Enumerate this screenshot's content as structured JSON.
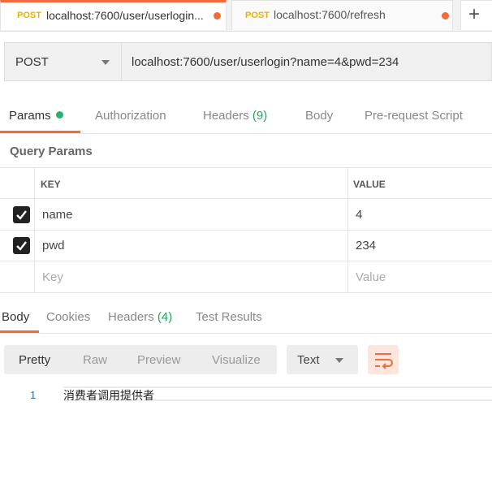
{
  "tabs": [
    {
      "method": "POST",
      "url": "localhost:7600/user/userlogin..."
    },
    {
      "method": "POST",
      "url": "localhost:7600/refresh"
    }
  ],
  "new_tab_label": "+",
  "request": {
    "method": "POST",
    "url": "localhost:7600/user/userlogin?name=4&pwd=234"
  },
  "request_tabs": {
    "params": "Params",
    "authorization": "Authorization",
    "headers": "Headers",
    "headers_count": "(9)",
    "body": "Body",
    "prerequest": "Pre-request Script"
  },
  "query_params": {
    "title": "Query Params",
    "col_key": "KEY",
    "col_value": "VALUE",
    "rows": [
      {
        "key": "name",
        "value": "4",
        "checked": true
      },
      {
        "key": "pwd",
        "value": "234",
        "checked": true
      }
    ],
    "key_placeholder": "Key",
    "value_placeholder": "Value"
  },
  "response_tabs": {
    "body": "Body",
    "cookies": "Cookies",
    "headers": "Headers",
    "headers_count": "(4)",
    "test_results": "Test Results"
  },
  "format": {
    "options": [
      "Pretty",
      "Raw",
      "Preview",
      "Visualize"
    ],
    "selected": "Pretty",
    "type": "Text"
  },
  "response_body": {
    "line_number": "1",
    "text": "消费者调用提供者"
  },
  "colors": {
    "accent": "#f26b3a",
    "method_post": "#e9b200",
    "count_green": "#26a65b",
    "line_number": "#2a6db5"
  }
}
